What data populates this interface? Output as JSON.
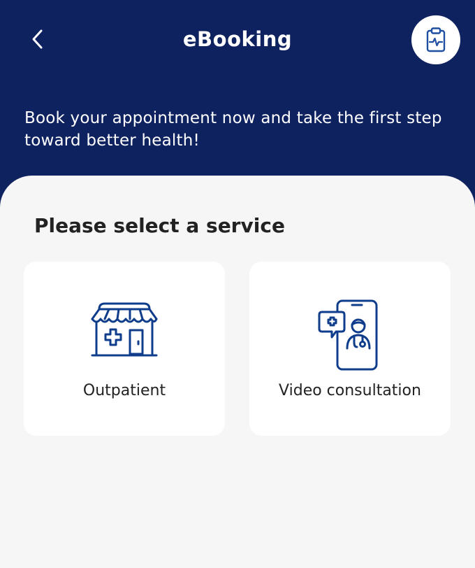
{
  "header": {
    "title": "eBooking",
    "back_icon": "chevron-left-icon",
    "action_icon": "clipboard-pulse-icon",
    "tagline": "Book your appointment now and take the first step toward better health!"
  },
  "main": {
    "section_title": "Please select a service",
    "services": [
      {
        "label": "Outpatient",
        "icon": "clinic-storefront-icon"
      },
      {
        "label": "Video consultation",
        "icon": "phone-doctor-icon"
      }
    ]
  },
  "colors": {
    "primary": "#0f2260",
    "background": "#f6f6f6",
    "card": "#ffffff",
    "text": "#222222"
  }
}
